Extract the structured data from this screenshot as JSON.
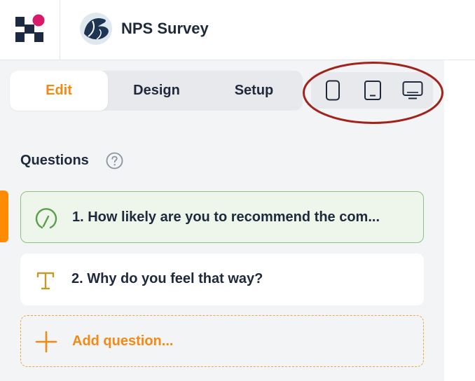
{
  "app": {
    "logo_icon": "brand-logo-icon",
    "survey_avatar_icon": "survey-avatar-icon",
    "survey_title": "NPS Survey"
  },
  "tabs": [
    {
      "label": "Edit",
      "active": true
    },
    {
      "label": "Design",
      "active": false
    },
    {
      "label": "Setup",
      "active": false
    }
  ],
  "device_preview": {
    "icons": [
      "mobile-phone-icon",
      "tablet-icon",
      "desktop-monitor-icon"
    ],
    "annotation_color": "#a0241c"
  },
  "questions_section": {
    "title": "Questions",
    "help_icon": "question-circle-icon"
  },
  "questions": [
    {
      "text": "1. How likely are you to recommend the com...",
      "icon": "nps-gauge-icon",
      "selected": true
    },
    {
      "text": "2. Why do you feel that way?",
      "icon": "text-type-icon",
      "selected": false
    }
  ],
  "add_question": {
    "label": "Add question...",
    "icon": "plus-icon"
  },
  "colors": {
    "accent": "#f28a16",
    "selected_bg": "#eef6ec",
    "selected_border": "#8cc27c",
    "panel_bg": "#f3f4f6"
  }
}
